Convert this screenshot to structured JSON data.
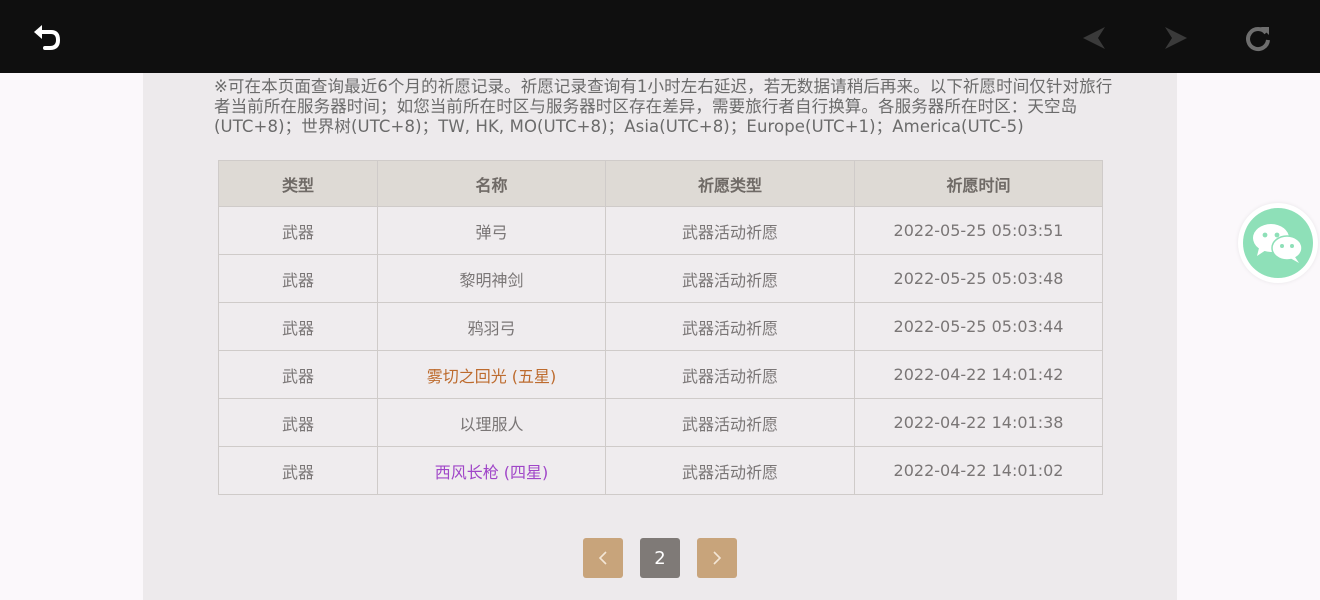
{
  "topbar": {
    "icons": [
      "back-arrow-icon",
      "nav-prev-icon",
      "nav-next-icon",
      "refresh-icon"
    ],
    "colors": {
      "background": "#0f0f0f",
      "active_icon": "#ffffff",
      "disabled_icon": "#3a3a3a",
      "refresh_icon": "#6e6e6e"
    }
  },
  "notice": "※可在本页面查询最近6个月的祈愿记录。祈愿记录查询有1小时左右延迟，若无数据请稍后再来。以下祈愿时间仅针对旅行者当前所在服务器时间；如您当前所在时区与服务器时区存在差异，需要旅行者自行换算。各服务器所在时区：天空岛(UTC+8)；世界树(UTC+8)；TW, HK, MO(UTC+8)；Asia(UTC+8)；Europe(UTC+1)；America(UTC-5)",
  "table": {
    "headers": [
      "类型",
      "名称",
      "祈愿类型",
      "祈愿时间"
    ],
    "rows": [
      {
        "type": "武器",
        "name": "弹弓",
        "wish_type": "武器活动祈愿",
        "time": "2022-05-25 05:03:51"
      },
      {
        "type": "武器",
        "name": "黎明神剑",
        "wish_type": "武器活动祈愿",
        "time": "2022-05-25 05:03:48"
      },
      {
        "type": "武器",
        "name": "鸦羽弓",
        "wish_type": "武器活动祈愿",
        "time": "2022-05-25 05:03:44"
      },
      {
        "type": "武器",
        "name": "雾切之回光 (五星)",
        "wish_type": "武器活动祈愿",
        "time": "2022-04-22 14:01:42"
      },
      {
        "type": "武器",
        "name": "以理服人",
        "wish_type": "武器活动祈愿",
        "time": "2022-04-22 14:01:38"
      },
      {
        "type": "武器",
        "name": "西风长枪 (四星)",
        "wish_type": "武器活动祈愿",
        "time": "2022-04-22 14:01:02"
      }
    ],
    "colors": {
      "five_star": "#bd6b2e",
      "four_star": "#a046c8"
    }
  },
  "pagination": {
    "current_page": "2",
    "prev_icon": "chevron-left-icon",
    "next_icon": "chevron-right-icon"
  },
  "floating": {
    "icon": "wechat-icon",
    "color": "#8ee0b8"
  }
}
